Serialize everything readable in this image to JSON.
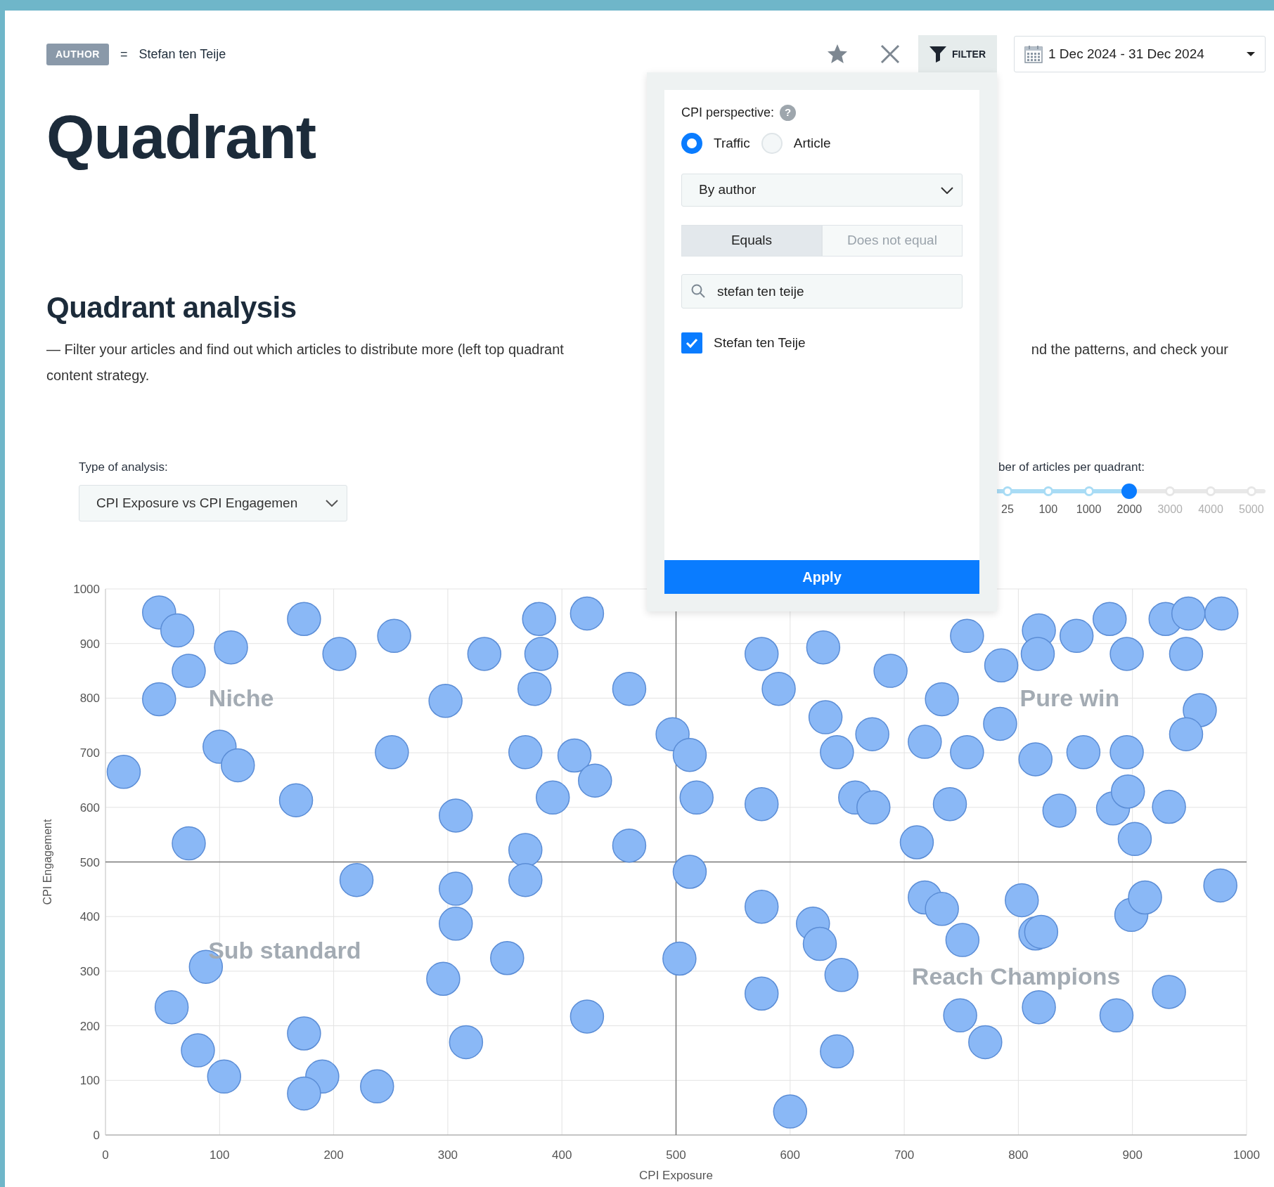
{
  "filter_chip": {
    "label": "AUTHOR",
    "operator": "=",
    "value": "Stefan ten Teije"
  },
  "toolbar": {
    "filter_button": {
      "label": "FILTER",
      "selected": true
    },
    "date_range": "1 Dec 2024 - 31 Dec 2024"
  },
  "title": "Quadrant",
  "section": {
    "heading": "Quadrant analysis",
    "description_parts": [
      "— Filter your articles and find out which articles to distribute more (left top quadrant",
      "nd the patterns, and check your",
      "content strategy."
    ]
  },
  "analysis_type": {
    "label": "Type of analysis:",
    "value": "CPI Exposure vs CPI Engagemen"
  },
  "articles_per_quadrant": {
    "label": "ber of articles per quadrant:",
    "ticks": [
      "25",
      "100",
      "1000",
      "2000",
      "3000",
      "4000",
      "5000"
    ],
    "level": 0.5
  },
  "filter_panel": {
    "perspective_label": "CPI perspective:",
    "help": "?",
    "perspective_options": [
      {
        "label": "Traffic",
        "selected": true
      },
      {
        "label": "Article",
        "selected": false
      }
    ],
    "dimension": "By author",
    "match_modes": [
      {
        "label": "Equals",
        "selected": true
      },
      {
        "label": "Does not equal",
        "selected": false
      }
    ],
    "search": {
      "value": "stefan ten teije"
    },
    "results": [
      {
        "label": "Stefan ten Teije",
        "checked": true
      }
    ],
    "apply": "Apply"
  },
  "chart": {
    "chart_data": {
      "type": "scatter",
      "xlabel": "CPI Exposure",
      "ylabel": "CPI Engagement",
      "xlim": [
        0,
        1000
      ],
      "ylim": [
        0,
        1000
      ],
      "xticks": [
        0,
        100,
        200,
        300,
        400,
        500,
        600,
        700,
        800,
        900,
        1000
      ],
      "yticks": [
        0,
        100,
        200,
        300,
        400,
        500,
        600,
        700,
        800,
        900,
        1000
      ],
      "x": [
        47,
        63,
        73,
        47,
        110,
        174,
        205,
        253,
        100,
        116,
        16,
        167,
        73,
        251,
        298,
        332,
        380,
        382,
        376,
        422,
        459,
        368,
        411,
        429,
        392,
        307,
        368,
        459,
        220,
        368,
        307,
        307,
        352,
        296,
        88,
        58,
        81,
        104,
        174,
        190,
        174,
        238,
        316,
        422,
        497,
        512,
        518,
        512,
        575,
        590,
        629,
        688,
        631,
        641,
        672,
        575,
        657,
        673,
        711,
        718,
        733,
        755,
        785,
        755,
        740,
        784,
        818,
        817,
        815,
        851,
        880,
        895,
        857,
        895,
        836,
        883,
        896,
        902,
        932,
        929,
        949,
        978,
        947,
        959,
        947,
        503,
        575,
        620,
        626,
        645,
        575,
        641,
        600,
        718,
        733,
        751,
        803,
        815,
        820,
        749,
        771,
        818,
        886,
        932,
        899,
        911,
        977
      ],
      "series": [
        {
          "color": "#8ab8f6",
          "values": [
            957,
            924,
            850,
            798,
            893,
            945,
            881,
            914,
            711,
            677,
            665,
            613,
            534,
            701,
            795,
            881,
            945,
            881,
            817,
            955,
            817,
            701,
            695,
            649,
            618,
            585,
            522,
            530,
            467,
            467,
            451,
            387,
            324,
            286,
            308,
            234,
            155,
            107,
            186,
            107,
            76,
            89,
            170,
            217,
            734,
            696,
            618,
            482,
            881,
            817,
            893,
            850,
            765,
            701,
            734,
            606,
            618,
            600,
            536,
            720,
            798,
            914,
            860,
            701,
            606,
            753,
            924,
            881,
            688,
            914,
            945,
            881,
            701,
            701,
            594,
            598,
            629,
            542,
            601,
            945,
            955,
            955,
            881,
            778,
            734,
            323,
            418,
            387,
            350,
            293,
            259,
            153,
            43,
            435,
            414,
            357,
            430,
            369,
            372,
            219,
            170,
            234,
            219,
            262,
            403,
            435,
            457
          ]
        }
      ],
      "grid": true,
      "annotations": [
        "Niche",
        "Pure win",
        "Sub standard",
        "Reach Champions"
      ]
    }
  }
}
